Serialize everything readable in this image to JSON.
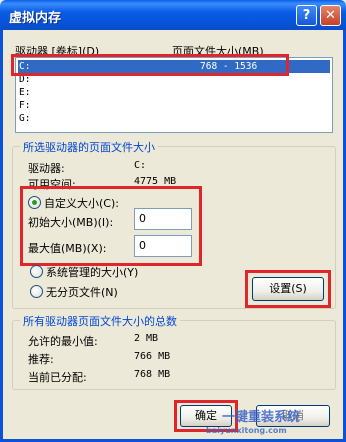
{
  "window": {
    "title": "虚拟内存",
    "help_glyph": "?",
    "close_glyph": "✕"
  },
  "drive_list": {
    "header_drive": "驱动器 [卷标](D)",
    "header_size": "页面文件大小(MB)",
    "rows": [
      {
        "drive": "C:",
        "size": "768 - 1536"
      },
      {
        "drive": "D:",
        "size": ""
      },
      {
        "drive": "E:",
        "size": ""
      },
      {
        "drive": "F:",
        "size": ""
      },
      {
        "drive": "G:",
        "size": ""
      }
    ]
  },
  "selected_drive": {
    "legend": "所选驱动器的页面文件大小",
    "drive_label": "驱动器:",
    "drive_value": "C:",
    "space_label": "可用空间:",
    "space_value": "4775 MB",
    "custom_label": "自定义大小(C):",
    "initial_label": "初始大小(MB)(I):",
    "initial_value": "0",
    "max_label": "最大值(MB)(X):",
    "max_value": "0",
    "system_label": "系统管理的大小(Y)",
    "none_label": "无分页文件(N)",
    "set_button": "设置(S)"
  },
  "totals": {
    "legend": "所有驱动器页面文件大小的总数",
    "min_label": "允许的最小值:",
    "min_value": "2 MB",
    "rec_label": "推荐:",
    "rec_value": "766 MB",
    "cur_label": "当前已分配:",
    "cur_value": "768 MB"
  },
  "footer": {
    "ok_button": "确定",
    "cancel_button": "取消"
  },
  "watermark": {
    "text": "一键重装系统",
    "sub": "baiyunxitong.com"
  },
  "colors": {
    "titlebar": "#0a5ee8",
    "highlight": "#e0262a",
    "selection": "#316ac5"
  }
}
